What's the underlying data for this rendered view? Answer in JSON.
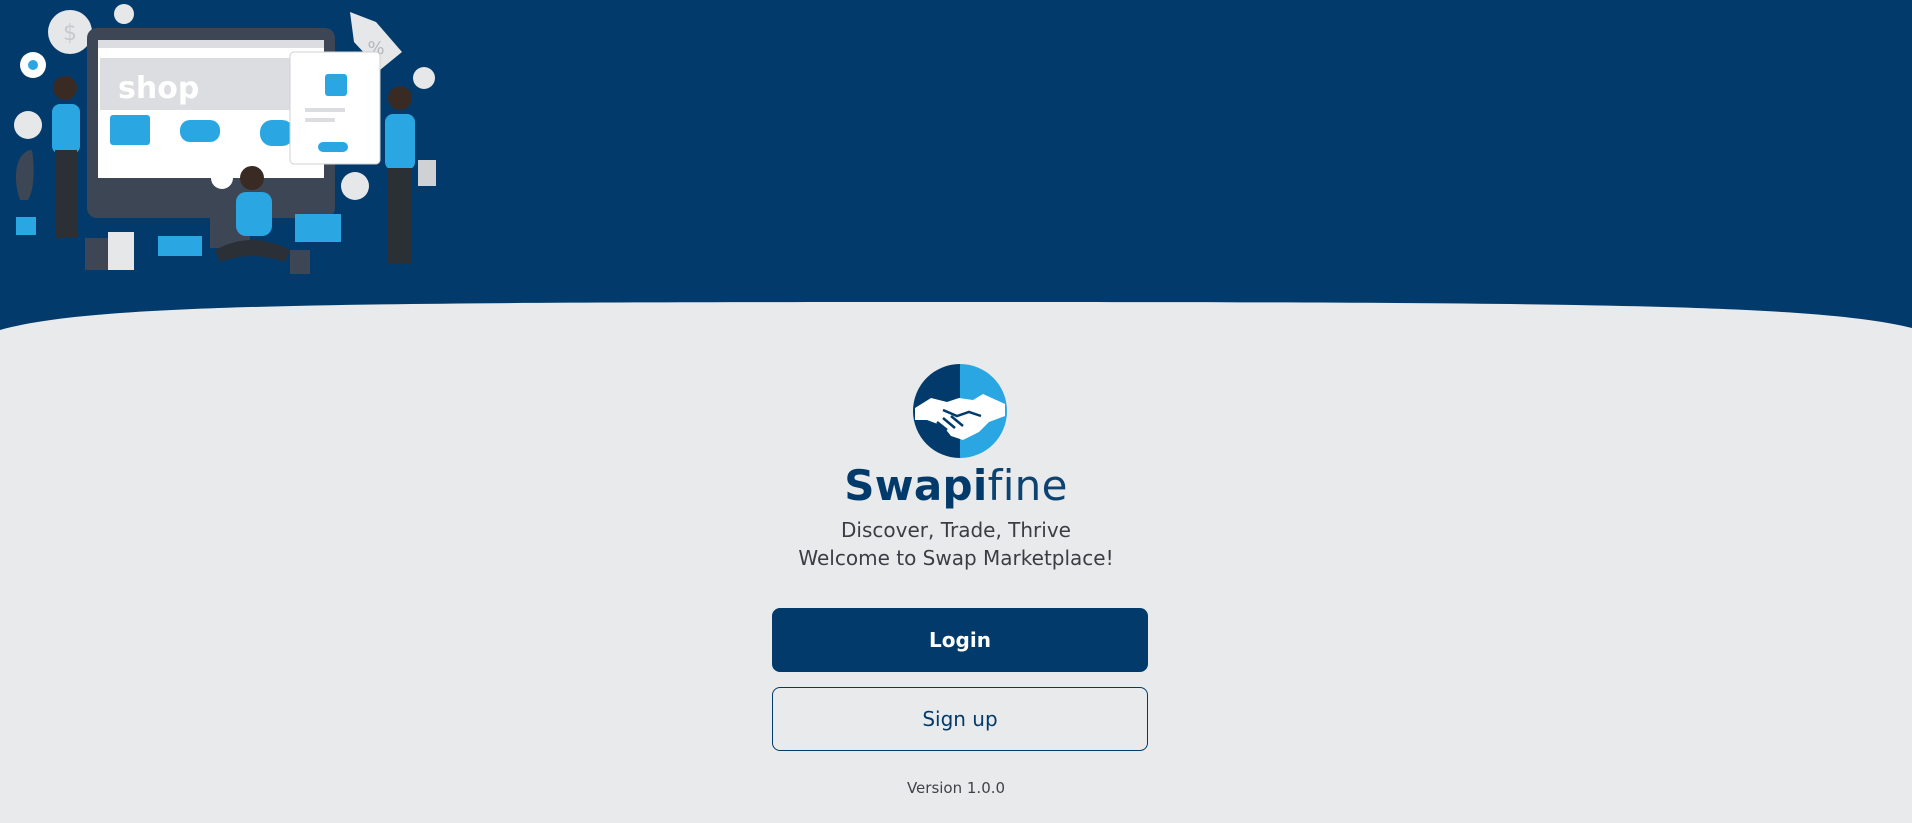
{
  "colors": {
    "primary": "#023b6b",
    "accent": "#2aa6e2",
    "background": "#e9eaeb"
  },
  "hero": {
    "illustration_icon": "online-shopping-illustration-icon",
    "illustration_text": "shop"
  },
  "brand": {
    "logo_icon": "handshake-icon",
    "name_bold": "Swapi",
    "name_light": "fine"
  },
  "tagline": "Discover, Trade, Thrive",
  "welcome": "Welcome to Swap Marketplace!",
  "buttons": {
    "login": "Login",
    "signup": "Sign up"
  },
  "version": "Version 1.0.0"
}
